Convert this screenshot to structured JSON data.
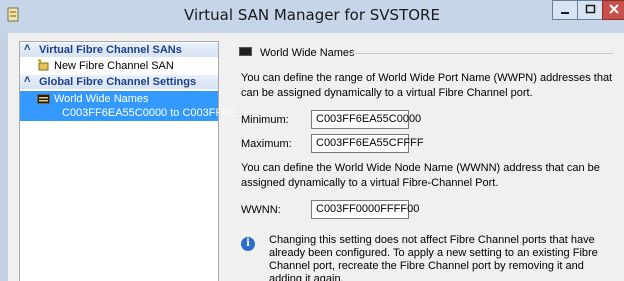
{
  "window": {
    "title": "Virtual SAN Manager for SVSTORE"
  },
  "tree": {
    "sections": [
      {
        "label": "Virtual Fibre Channel SANs"
      },
      {
        "label": "Global Fibre Channel Settings"
      }
    ],
    "new_san_label": "New Fibre Channel SAN",
    "wwn_item": {
      "label": "World Wide Names",
      "subtitle": "C003FF6EA55C0000 to C003FF6E..."
    }
  },
  "details": {
    "section_title": "World Wide Names",
    "wwpn_description": "You can define the range of World Wide Port Name (WWPN) addresses that can be assigned dynamically to a virtual Fibre Channel port.",
    "minimum_label": "Minimum:",
    "minimum_value": "C003FF6EA55C0000",
    "maximum_label": "Maximum:",
    "maximum_value": "C003FF6EA55CFFFF",
    "wwnn_description": "You can define the World Wide Node Name (WWNN) address that can be assigned dynamically to a virtual Fibre-Channel Port.",
    "wwnn_label": "WWNN:",
    "wwnn_value": "C003FF0000FFFF00",
    "info_text": "Changing this setting does not affect Fibre Channel ports that have already been configured. To apply a new setting to an existing Fibre Channel port, recreate the Fibre Channel port by removing it and adding it again."
  },
  "colors": {
    "selection": "#3399ff",
    "section_header_text": "#1c3f8c"
  }
}
